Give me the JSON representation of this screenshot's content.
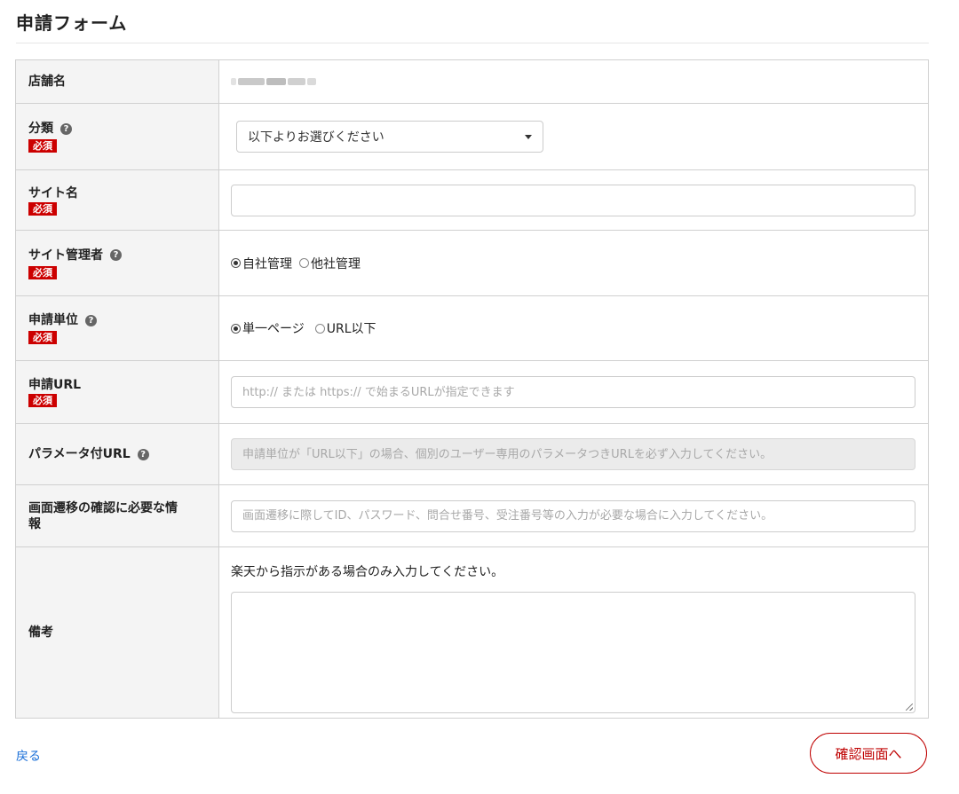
{
  "page": {
    "title": "申請フォーム"
  },
  "icons": {
    "help": "question-circle-icon",
    "required_color": "#cc0000",
    "accent": "#bf0000",
    "link": "#1a6fd8"
  },
  "fields": {
    "store_name": {
      "label": "店舗名"
    },
    "category": {
      "label": "分類",
      "required": "必須",
      "selected": "以下よりお選びください"
    },
    "site_name": {
      "label": "サイト名",
      "required": "必須",
      "value": ""
    },
    "site_admin": {
      "label": "サイト管理者",
      "required": "必須",
      "options": [
        "自社管理",
        "他社管理"
      ],
      "selected_index": 0
    },
    "unit": {
      "label": "申請単位",
      "required": "必須",
      "options": [
        "単一ページ",
        "URL以下"
      ],
      "selected_index": 0
    },
    "url": {
      "label": "申請URL",
      "required": "必須",
      "placeholder": "http:// または https:// で始まるURLが指定できます"
    },
    "param_url": {
      "label": "パラメータ付URL",
      "placeholder": "申請単位が「URL以下」の場合、個別のユーザー専用のパラメータつきURLを必ず入力してください。"
    },
    "transition_info": {
      "label": "画面遷移の確認に必要な情報",
      "placeholder": "画面遷移に際してID、パスワード、問合せ番号、受注番号等の入力が必要な場合に入力してください。"
    },
    "remarks": {
      "label": "備考",
      "note": "楽天から指示がある場合のみ入力してください。"
    }
  },
  "footer": {
    "back_label": "戻る",
    "confirm_label": "確認画面へ"
  }
}
